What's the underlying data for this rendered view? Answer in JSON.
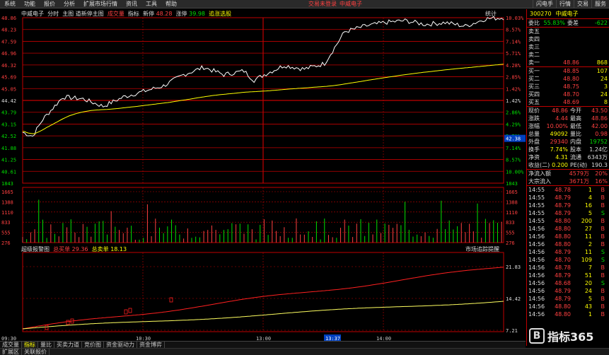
{
  "menubar": {
    "items": [
      "系统",
      "功能",
      "报价",
      "分析",
      "扩展市场行情",
      "资讯",
      "工具",
      "帮助"
    ],
    "notice": "交易未登录",
    "notice2": "中威电子",
    "right": [
      "闪电手",
      "行情",
      "交易",
      "服务"
    ]
  },
  "chart": {
    "title_stock": "中威电子",
    "title_items": [
      "分时",
      "主图",
      "道新停主图"
    ],
    "cjl_label": "成交量",
    "indicator_label": "指标",
    "new_price_label": "新停",
    "new_price": "48.28",
    "strength_label": "涨停",
    "strength": "39.98",
    "extra_label": "追涨选股",
    "stat_label": "统计",
    "price_ticks_left": [
      "48.86",
      "48.23",
      "47.59",
      "46.96",
      "46.32",
      "45.69",
      "45.05",
      "44.42",
      "43.79",
      "43.15",
      "42.52",
      "41.88",
      "41.25",
      "40.61",
      "1843"
    ],
    "pct_ticks_right": [
      "10.03%",
      "8.57%",
      "7.14%",
      "5.71%",
      "4.28%",
      "2.85%",
      "1.42%",
      "1.42%",
      "2.86%",
      "4.29%",
      "5.71%",
      "7.14%",
      "8.57%",
      "10.00%",
      "1843"
    ],
    "vol_ticks": [
      "1665",
      "1388",
      "1110",
      "833",
      "555",
      "276"
    ],
    "current_price_tag": "42.38",
    "sub_title": "超级报警图",
    "sub_a_label": "总买单",
    "sub_a_val": "29.36",
    "sub_b_label": "总卖单",
    "sub_b_val": "18.13",
    "sub_right_label": "市场追踪提醒",
    "sub_ticks": [
      "21.83",
      "14.42",
      "7.21"
    ],
    "time_labels": [
      "09:30",
      "10:30",
      "13:00",
      "14:00"
    ],
    "cursor_time": "13:37"
  },
  "panel": {
    "code": "300270",
    "name": "中威电子",
    "wei_bi_label": "委比",
    "wei_bi": "55.83%",
    "wei_cha_label": "委差",
    "wei_cha": "-622",
    "sell": [
      {
        "label": "卖五",
        "price": "",
        "vol": ""
      },
      {
        "label": "卖四",
        "price": "",
        "vol": ""
      },
      {
        "label": "卖三",
        "price": "",
        "vol": ""
      },
      {
        "label": "卖二",
        "price": "",
        "vol": ""
      },
      {
        "label": "卖一",
        "price": "48.86",
        "vol": "868"
      }
    ],
    "buy": [
      {
        "label": "买一",
        "price": "48.85",
        "vol": "107"
      },
      {
        "label": "买二",
        "price": "48.80",
        "vol": "24"
      },
      {
        "label": "买三",
        "price": "48.75",
        "vol": "3"
      },
      {
        "label": "买四",
        "price": "48.70",
        "vol": "24"
      },
      {
        "label": "买五",
        "price": "48.69",
        "vol": "8"
      }
    ],
    "quote": [
      {
        "l1": "现价",
        "v1": "48.86",
        "l2": "今开",
        "v2": "43.50"
      },
      {
        "l1": "涨跌",
        "v1": "4.44",
        "l2": "最高",
        "v2": "48.86"
      },
      {
        "l1": "涨幅",
        "v1": "10.00%",
        "l2": "最低",
        "v2": "42.00"
      },
      {
        "l1": "总量",
        "v1": "49092",
        "l2": "量比",
        "v2": "0.98"
      },
      {
        "l1": "外盘",
        "v1": "29340",
        "l2": "内盘",
        "v2": "19752"
      },
      {
        "l1": "换手",
        "v1": "7.74%",
        "l2": "股本",
        "v2": "1.24亿"
      },
      {
        "l1": "净资",
        "v1": "4.31",
        "l2": "流通",
        "v2": "6343万"
      },
      {
        "l1": "收益(二)",
        "v1": "0.200",
        "l2": "PE(动)",
        "v2": "190.3"
      }
    ],
    "flow": [
      {
        "l": "净流入额",
        "v": "4579万",
        "p": "20%"
      },
      {
        "l": "大宗流入",
        "v": "3671万",
        "p": "16%"
      }
    ],
    "ticks": [
      {
        "t": "14:55",
        "p": "48.78",
        "v": "1",
        "d": "B"
      },
      {
        "t": "14:55",
        "p": "48.79",
        "v": "4",
        "d": "B"
      },
      {
        "t": "14:55",
        "p": "48.79",
        "v": "16",
        "d": "B"
      },
      {
        "t": "14:55",
        "p": "48.79",
        "v": "5",
        "d": "S"
      },
      {
        "t": "14:55",
        "p": "48.80",
        "v": "200",
        "d": "B"
      },
      {
        "t": "14:56",
        "p": "48.80",
        "v": "27",
        "d": "B"
      },
      {
        "t": "14:56",
        "p": "48.80",
        "v": "11",
        "d": "B"
      },
      {
        "t": "14:56",
        "p": "48.80",
        "v": "2",
        "d": "B"
      },
      {
        "t": "14:56",
        "p": "48.79",
        "v": "11",
        "d": "S"
      },
      {
        "t": "14:56",
        "p": "48.70",
        "v": "109",
        "d": "S"
      },
      {
        "t": "14:56",
        "p": "48.78",
        "v": "7",
        "d": "B"
      },
      {
        "t": "14:56",
        "p": "48.79",
        "v": "51",
        "d": "B"
      },
      {
        "t": "14:56",
        "p": "48.68",
        "v": "20",
        "d": "S"
      },
      {
        "t": "14:56",
        "p": "48.79",
        "v": "24",
        "d": "B"
      },
      {
        "t": "14:56",
        "p": "48.79",
        "v": "5",
        "d": "B"
      },
      {
        "t": "14:56",
        "p": "48.80",
        "v": "43",
        "d": "B"
      },
      {
        "t": "14:56",
        "p": "48.80",
        "v": "1",
        "d": "B"
      }
    ]
  },
  "tabs": [
    "成交量",
    "指标",
    "量比",
    "买卖力道",
    "竞价图",
    "资金驱动力",
    "资金博弈"
  ],
  "status": [
    "扩展区",
    "关联报价"
  ],
  "watermark": "指标365",
  "colors": {
    "bg": "#000000",
    "grid": "#c00000",
    "price_line": "#ffffff",
    "avg_line": "#ffff00",
    "up": "#ff4040",
    "down": "#00e000"
  }
}
